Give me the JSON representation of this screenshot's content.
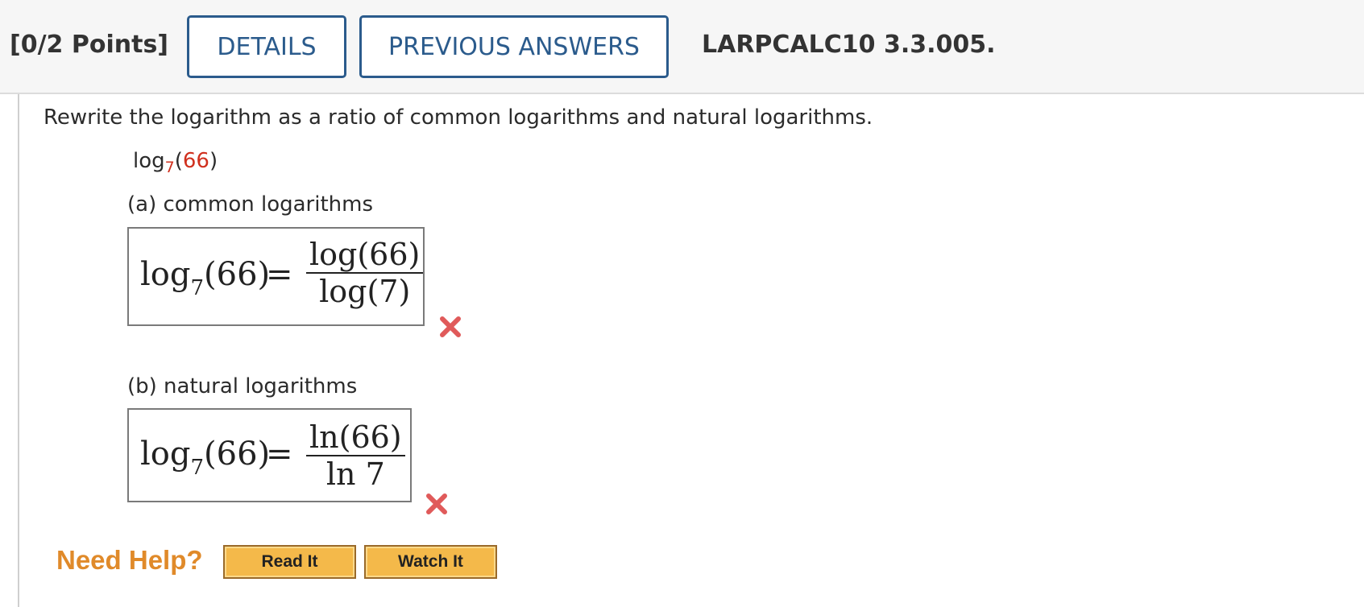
{
  "header": {
    "points": "[0/2 Points]",
    "details_label": "DETAILS",
    "previous_answers_label": "PREVIOUS ANSWERS",
    "problem_code": "LARPCALC10 3.3.005."
  },
  "question": {
    "prompt": "Rewrite the logarithm as a ratio of common logarithms and natural logarithms.",
    "given_log": "log",
    "given_base": "7",
    "given_open": "(",
    "given_arg": "66",
    "given_close": ")"
  },
  "part_a": {
    "label": "(a) common logarithms",
    "lhs_log": "log",
    "lhs_base": "7",
    "lhs_arg": "(66)",
    "equals": "=",
    "numerator": "log(66)",
    "denominator": "log(7)",
    "status": "incorrect"
  },
  "part_b": {
    "label": "(b) natural logarithms",
    "lhs_log": "log",
    "lhs_base": "7",
    "lhs_arg": "(66)",
    "equals": "=",
    "numerator": "ln(66)",
    "denominator": "ln 7",
    "status": "incorrect"
  },
  "help": {
    "label": "Need Help?",
    "read_it": "Read It",
    "watch_it": "Watch It"
  },
  "colors": {
    "accent_blue": "#2b5b8c",
    "given_arg_red": "#d0301e",
    "incorrect_mark": "#e05a5a",
    "help_orange": "#e08a2a",
    "help_button": "#f4b94a"
  }
}
